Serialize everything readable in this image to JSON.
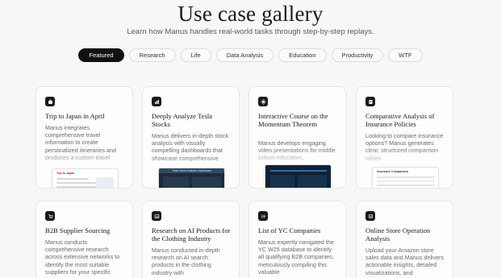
{
  "header": {
    "title": "Use case gallery",
    "subtitle": "Learn how Manus handles real-world tasks through step-by-step replays."
  },
  "filters": [
    "Featured",
    "Research",
    "Life",
    "Data Analysis",
    "Education",
    "Productivity",
    "WTF"
  ],
  "active_filter": "Featured",
  "cards": [
    {
      "title": "Trip to Japan in April",
      "desc": "Manus integrates comprehensive travel information to create personalized itineraries and produces a custom travel",
      "icon": "suitcase-icon"
    },
    {
      "title": "Deeply Analyze Tesla Stocks",
      "desc": "Manus delivers in-depth stock analysis with visually compelling dashboards that showcase comprehensive",
      "icon": "chart-icon"
    },
    {
      "title": "Interactive Course on the Momentum Theorem",
      "desc": "Manus develops engaging video presentations for middle school educators,",
      "icon": "atom-icon"
    },
    {
      "title": "Comparative Analysis of Insurance Policies",
      "desc": "Looking to compare insurance options? Manus generates clear, structured comparison tables",
      "icon": "document-icon"
    },
    {
      "title": "B2B Supplier Sourcing",
      "desc": "Manus conducts comprehensive research across extensive networks to identify the most suitable suppliers for your specific",
      "icon": "cart-icon"
    },
    {
      "title": "Research on AI Products for the Clothing Industry",
      "desc": "Manus conducted in-depth research on AI search products in the clothing industry with",
      "icon": "image-icon"
    },
    {
      "title": "List of YC Companies",
      "desc": "Manus expertly navigated the YC W25 database to identify all qualifying B2B companies, meticulously compiling this valuable",
      "icon": "list-icon"
    },
    {
      "title": "Online Store Operation Analysis",
      "desc": "Upload your Amazon store sales data and Manus delivers actionable insights, detailed visualizations, and",
      "icon": "store-icon"
    }
  ],
  "thumbs": {
    "card0": "Trip to Japan",
    "card1": "Tesla Stock Analysis Dashboard",
    "card3": "Insurance Comparison"
  },
  "colors": {
    "accent": "#111111",
    "background": "#f7f7f5",
    "card": "#fdfdfc"
  }
}
